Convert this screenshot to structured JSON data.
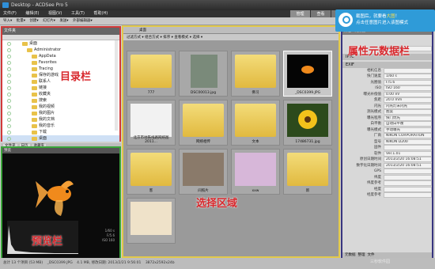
{
  "window": {
    "title": "Desktop - ACDSee Pro 5"
  },
  "menubar": {
    "items": [
      "文件(F)",
      "编辑(E)",
      "视图(V)",
      "工具(T)",
      "帮助(H)"
    ]
  },
  "modes": {
    "items": [
      "管理",
      "查看",
      "编辑"
    ]
  },
  "toolbar": {
    "items": [
      "导入▾",
      "批量▾",
      "创建▾",
      "幻灯片▾",
      "发送▾",
      "外部编辑器▾"
    ]
  },
  "folder_panel": {
    "title": "文件夹",
    "items": [
      "桌面",
      "Administrator",
      "AppData",
      "Favorites",
      "Tracing",
      "保存的游戏",
      "联系人",
      "链接",
      "收藏夹",
      "搜索",
      "我的视频",
      "我的图片",
      "我的文档",
      "我的音乐",
      "下载",
      "桌面"
    ],
    "tabs": [
      "文件夹",
      "日历",
      "收藏夹"
    ]
  },
  "preview_panel": {
    "title": "预览",
    "info": [
      "1/60 s",
      "F/5.6",
      "ISO 160"
    ]
  },
  "browser": {
    "path": "桌面",
    "toolbar": "过滤方式 ▾  组合方式 ▾  排序 ▾  查看模式 ▾  选择 ▾",
    "tiles": [
      {
        "label": "777"
      },
      {
        "label": "DSC00013.jpg"
      },
      {
        "label": "佛习"
      },
      {
        "label": "_DSC0399.JPG"
      },
      {
        "label": "北京市地铁线路网络图2011..."
      },
      {
        "label": "网络相传"
      },
      {
        "label": "文本"
      },
      {
        "label": "17486731.jpg"
      },
      {
        "label": "客"
      },
      {
        "label": "间照片"
      },
      {
        "label": "xxw"
      },
      {
        "label": "新"
      },
      {
        "label": ""
      }
    ]
  },
  "properties": {
    "title": "属性 - 元数据",
    "preset": "元数据视图",
    "section_iptc": "IPTC",
    "section_exif": "EXIF",
    "rows": [
      [
        "相机信息",
        ""
      ],
      [
        "快门速度",
        "1/60 s"
      ],
      [
        "光圈值",
        "F/5.6"
      ],
      [
        "ISO",
        "ISO 160"
      ],
      [
        "曝光补偿值",
        "0.00 eV"
      ],
      [
        "焦距",
        "20.0 mm"
      ],
      [
        "闪光",
        "闪光灯未闪光"
      ],
      [
        "测光模式",
        "图案"
      ],
      [
        "曝光程序",
        "快门优先"
      ],
      [
        "白平衡",
        "自动白平衡"
      ],
      [
        "曝光模式",
        "手动曝光"
      ],
      [
        "厂商",
        "NIKON CORPORATION"
      ],
      [
        "型号",
        "NIKON D200"
      ],
      [
        "固件",
        ""
      ],
      [
        "软件",
        "Ver.1.01"
      ],
      [
        "原创日期时间",
        "2013/2/20 16:08:51"
      ],
      [
        "数字化日期时间",
        "2013/2/20 16:08:51"
      ],
      [
        "GPS",
        ""
      ],
      [
        "纬度",
        ""
      ],
      [
        "纬度参考",
        ""
      ],
      [
        "经度",
        ""
      ],
      [
        "经度参考",
        ""
      ]
    ],
    "tabs": [
      "元数据",
      "整理",
      "文件"
    ]
  },
  "status": {
    "total": "总计 13 个项目 (53 MB)",
    "file": "_DSC0399.JPG",
    "size": "4.1 MB, 修改日期: 2013/2/21 9:56:01",
    "dims": "3872x2592x24b"
  },
  "annotations": {
    "tree": "目录栏",
    "preview": "预览栏",
    "browse": "选择区域",
    "props": "属性元数据栏"
  },
  "banner": {
    "line1": "截图后，就要看",
    "zoom": "大图",
    "line1b": "！",
    "line2": "点击任意图片进入该图模式"
  },
  "watermark": "三秒软件园"
}
